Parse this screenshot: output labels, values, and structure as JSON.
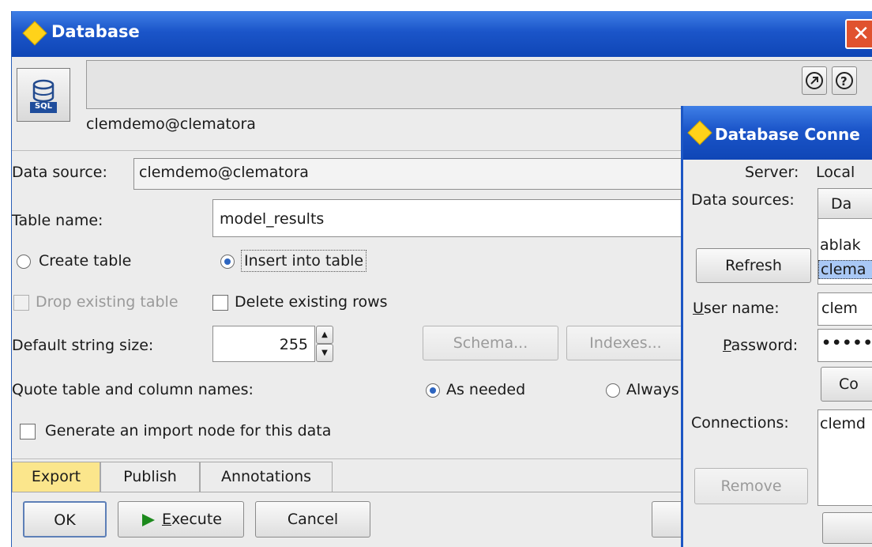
{
  "main_window": {
    "title": "Database",
    "close_glyph": "✕",
    "toolbar": {
      "icon": "sql-database-icon",
      "badge": "SQL",
      "buttons": [
        "open-in-new-icon",
        "help-icon"
      ]
    },
    "connection_label": "clemdemo@clematora",
    "data_source": {
      "label": "Data source:",
      "value": "clemdemo@clematora"
    },
    "table_name": {
      "label": "Table name:",
      "value": "model_results"
    },
    "mode": {
      "options": [
        "Create table",
        "Insert into table"
      ],
      "selected": "Insert into table"
    },
    "drop_existing": {
      "label": "Drop existing table",
      "checked": false,
      "enabled": false
    },
    "delete_existing": {
      "label": "Delete existing rows",
      "checked": false
    },
    "default_string_size": {
      "label": "Default string size:",
      "value": "255"
    },
    "schema_button": "Schema...",
    "indexes_button": "Indexes...",
    "quote_names": {
      "label": "Quote table and column names:",
      "options": [
        "As needed",
        "Always"
      ],
      "selected": "As needed"
    },
    "generate_import": {
      "label": "Generate an import node for this data",
      "checked": false
    },
    "tabs": [
      "Export",
      "Publish",
      "Annotations"
    ],
    "active_tab": "Export",
    "buttons": {
      "ok": "OK",
      "execute_prefix": "E",
      "execute_rest": "xecute",
      "cancel": "Cancel",
      "partial": ""
    }
  },
  "conn_window": {
    "title": "Database Conne",
    "server": {
      "label": "Server:",
      "value": "Local"
    },
    "data_sources_label": "Data sources:",
    "data_sources_header": "Da",
    "data_sources_items": [
      "ablak",
      "clema"
    ],
    "refresh_button": "Refresh",
    "user_name": {
      "label_u": "U",
      "label_rest": "ser name:",
      "value": "clem"
    },
    "password": {
      "label_p": "P",
      "label_rest": "assword:",
      "value": "•••••"
    },
    "connect_button": "Co",
    "connections_label": "Connections:",
    "connections_items": [
      "clemd"
    ],
    "remove_button": "Remove"
  },
  "colors": {
    "title_bar": "#1b55c9",
    "active_tab": "#fbe68c",
    "selection": "#a9c8f5"
  }
}
